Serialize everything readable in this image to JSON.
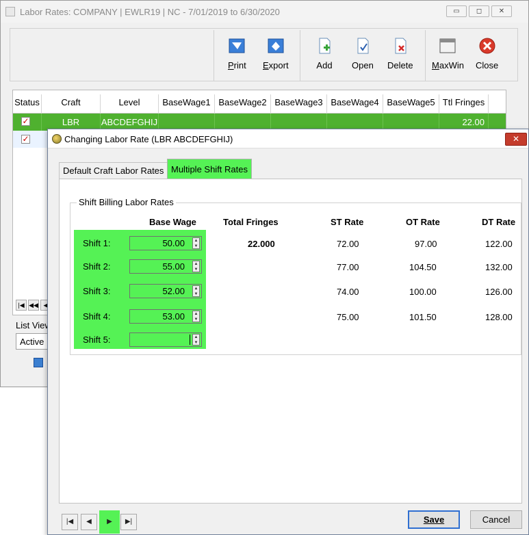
{
  "main_window": {
    "title": "Labor Rates: COMPANY | EWLR19 | NC -  7/01/2019 to  6/30/2020",
    "title_buttons": [
      "minimize",
      "maximize",
      "close"
    ],
    "toolbar": [
      {
        "label": "Print",
        "icon": "print-icon"
      },
      {
        "label": "Export",
        "icon": "export-icon"
      },
      {
        "label": "Add",
        "icon": "add-document-icon"
      },
      {
        "label": "Open",
        "icon": "open-document-icon"
      },
      {
        "label": "Delete",
        "icon": "delete-document-icon"
      },
      {
        "label": "MaxWin",
        "icon": "maximize-window-icon"
      },
      {
        "label": "Close",
        "icon": "close-circle-icon"
      }
    ],
    "grid": {
      "columns": [
        "Status",
        "Craft",
        "Level",
        "BaseWage1",
        "BaseWage2",
        "BaseWage3",
        "BaseWage4",
        "BaseWage5",
        "Ttl Fringes"
      ],
      "rows": [
        {
          "status": "✓",
          "craft": "LBR",
          "level": "ABCDEFGHIJ",
          "base1": "",
          "base2": "",
          "base3": "",
          "base4": "",
          "base5": "",
          "fringes": "22.00"
        },
        {
          "status": "✓"
        }
      ],
      "nav": [
        "|◀",
        "◀◀",
        "◀"
      ]
    },
    "list_view": {
      "label": "List View",
      "value": "Active"
    }
  },
  "dialog": {
    "title": "Changing Labor Rate  (LBR ABCDEFGHIJ)",
    "close": "✕",
    "tabs": [
      {
        "label": "Default Craft Labor Rates",
        "active": false
      },
      {
        "label": "Multiple Shift Rates",
        "active": true
      }
    ],
    "group_label": "Shift Billing Labor Rates",
    "headers": {
      "base_wage": "Base Wage",
      "total_fringes": "Total Fringes",
      "st_rate": "ST Rate",
      "ot_rate": "OT Rate",
      "dt_rate": "DT Rate"
    },
    "total_fringes_value": "22.000",
    "shifts": [
      {
        "label": "Shift 1:",
        "base_wage": "50.00",
        "st": "72.00",
        "ot": "97.00",
        "dt": "122.00"
      },
      {
        "label": "Shift 2:",
        "base_wage": "55.00",
        "st": "77.00",
        "ot": "104.50",
        "dt": "132.00"
      },
      {
        "label": "Shift 3:",
        "base_wage": "52.00",
        "st": "74.00",
        "ot": "100.00",
        "dt": "126.00"
      },
      {
        "label": "Shift 4:",
        "base_wage": "53.00",
        "st": "75.00",
        "ot": "101.50",
        "dt": "128.00"
      },
      {
        "label": "Shift 5:",
        "base_wage": "",
        "st": "",
        "ot": "",
        "dt": ""
      }
    ],
    "record_nav": [
      "|◀",
      "◀",
      "▶",
      "▶|"
    ],
    "buttons": {
      "save": "Save",
      "cancel": "Cancel"
    }
  },
  "colors": {
    "highlight": "#55f255",
    "selected_row": "#4fb12f",
    "accent_border": "#2f6fd1",
    "check": "#c80000"
  }
}
